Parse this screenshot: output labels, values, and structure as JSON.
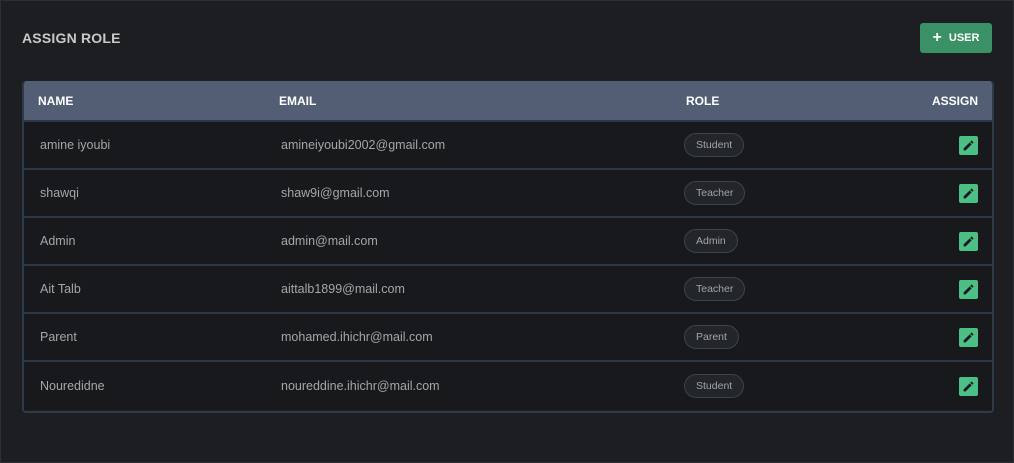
{
  "page": {
    "title": "ASSIGN ROLE"
  },
  "toolbar": {
    "add_user_label": "USER",
    "add_icon": "plus-icon"
  },
  "colors": {
    "accent": "#3b9166",
    "edit": "#4cbf86",
    "header_bg": "#525e73",
    "page_bg": "#1c1e21"
  },
  "table": {
    "headers": {
      "name": "NAME",
      "email": "EMAIL",
      "role": "ROLE",
      "assign": "ASSIGN"
    },
    "rows": [
      {
        "name": "amine iyoubi",
        "email": "amineiyoubi2002@gmail.com",
        "role": "Student"
      },
      {
        "name": "shawqi",
        "email": "shaw9i@gmail.com",
        "role": "Teacher"
      },
      {
        "name": "Admin",
        "email": "admin@mail.com",
        "role": "Admin"
      },
      {
        "name": "Ait Talb",
        "email": "aittalb1899@mail.com",
        "role": "Teacher"
      },
      {
        "name": "Parent",
        "email": "mohamed.ihichr@mail.com",
        "role": "Parent"
      },
      {
        "name": "Nouredidne",
        "email": "noureddine.ihichr@mail.com",
        "role": "Student"
      }
    ]
  }
}
